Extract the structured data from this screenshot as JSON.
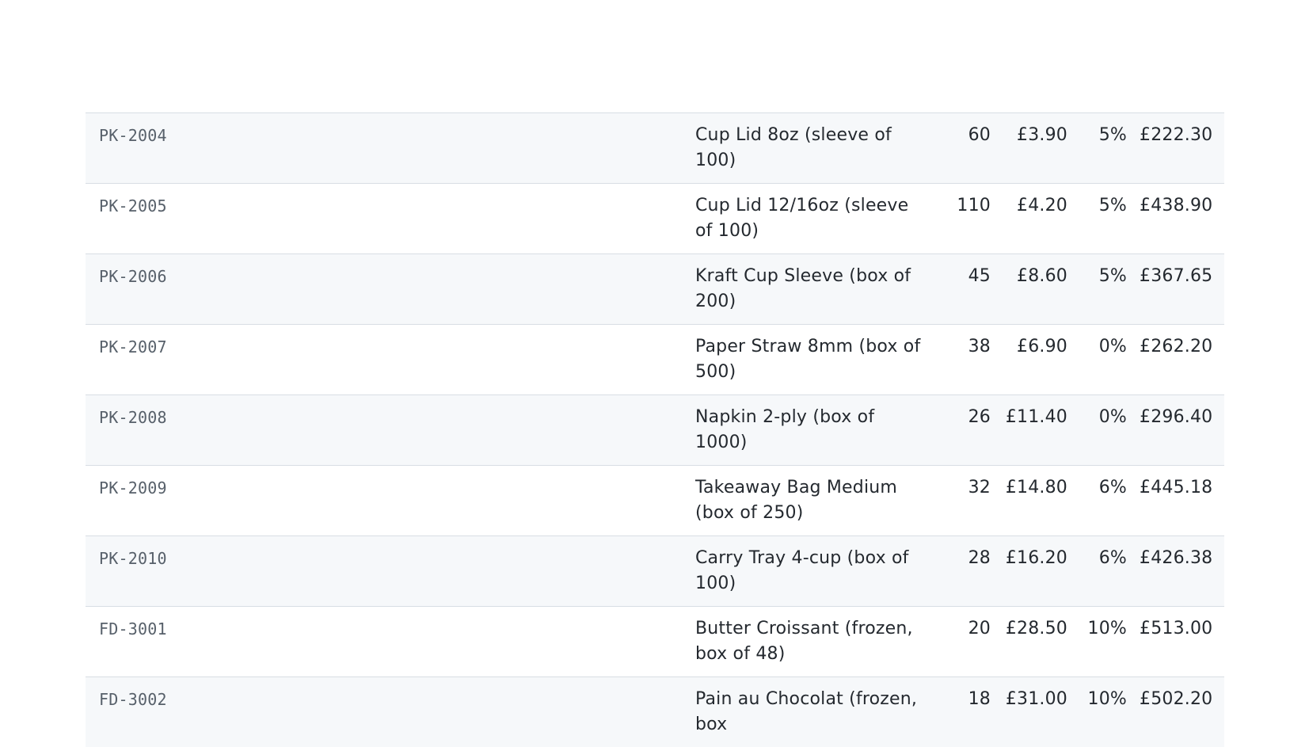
{
  "rows": [
    {
      "code": "PK-2004",
      "description": "Cup Lid 8oz (sleeve of 100)",
      "qty": "60",
      "unit_price": "£3.90",
      "discount": "5%",
      "total": "£222.30"
    },
    {
      "code": "PK-2005",
      "description": "Cup Lid 12/16oz (sleeve of 100)",
      "qty": "110",
      "unit_price": "£4.20",
      "discount": "5%",
      "total": "£438.90"
    },
    {
      "code": "PK-2006",
      "description": "Kraft Cup Sleeve (box of 200)",
      "qty": "45",
      "unit_price": "£8.60",
      "discount": "5%",
      "total": "£367.65"
    },
    {
      "code": "PK-2007",
      "description": "Paper Straw 8mm (box of 500)",
      "qty": "38",
      "unit_price": "£6.90",
      "discount": "0%",
      "total": "£262.20"
    },
    {
      "code": "PK-2008",
      "description": "Napkin 2-ply (box of 1000)",
      "qty": "26",
      "unit_price": "£11.40",
      "discount": "0%",
      "total": "£296.40"
    },
    {
      "code": "PK-2009",
      "description": "Takeaway Bag Medium (box of 250)",
      "qty": "32",
      "unit_price": "£14.80",
      "discount": "6%",
      "total": "£445.18"
    },
    {
      "code": "PK-2010",
      "description": "Carry Tray 4-cup (box of 100)",
      "qty": "28",
      "unit_price": "£16.20",
      "discount": "6%",
      "total": "£426.38"
    },
    {
      "code": "FD-3001",
      "description": "Butter Croissant (frozen, box of 48)",
      "qty": "20",
      "unit_price": "£28.50",
      "discount": "10%",
      "total": "£513.00"
    },
    {
      "code": "FD-3002",
      "description": "Pain au Chocolat (frozen, box",
      "qty": "18",
      "unit_price": "£31.00",
      "discount": "10%",
      "total": "£502.20"
    }
  ]
}
